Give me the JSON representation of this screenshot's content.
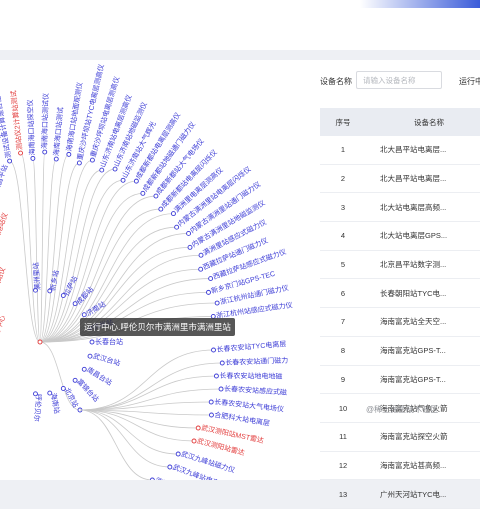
{
  "colors": {
    "link": "#3b3bd6",
    "alert": "#e23a3a",
    "edge": "#c9c9c9",
    "node_fill": "#ffffff"
  },
  "tooltip": {
    "text": "运行中心.呼伦贝尔市满洲里市满洲里站"
  },
  "tree": {
    "left_fragments": [
      {
        "text": "ceshi",
        "color": "link"
      },
      {
        "text": "北大昌平站",
        "color": "link"
      },
      {
        "text": "防城港站仪",
        "color": "alert"
      },
      {
        "text": "测试站仪",
        "color": "alert"
      },
      {
        "text": "运行中心",
        "color": "alert"
      }
    ],
    "fan_labels": [
      {
        "text": "测试设备计算是否在线",
        "color": "link"
      },
      {
        "text": "测站仪2计算站测试",
        "color": "alert"
      },
      {
        "text": "海南海口站探空仪",
        "color": "link"
      },
      {
        "text": "海南海口站测试仪",
        "color": "link"
      },
      {
        "text": "海南海口站测试",
        "color": "link"
      },
      {
        "text": "海南海口站地面观测仪",
        "color": "link"
      },
      {
        "text": "重庆沙坪坝站TYC电离层测高仪",
        "color": "link"
      },
      {
        "text": "重庆沙坪坝站电离层测高仪",
        "color": "link"
      },
      {
        "text": "山东济南站电离层测高仪",
        "color": "link"
      },
      {
        "text": "山东济南站地磁监测仪",
        "color": "link"
      },
      {
        "text": "山东济南站大气辉光",
        "color": "link"
      },
      {
        "text": "成都新都站电离层测高仪",
        "color": "link"
      },
      {
        "text": "成都新都站地磁通门磁力仪",
        "color": "link"
      },
      {
        "text": "成都新都站大气电场仪",
        "color": "link"
      },
      {
        "text": "成都新都站电离层闪烁仪",
        "color": "link"
      },
      {
        "text": "满洲里电离层测高仪",
        "color": "link"
      },
      {
        "text": "内蒙古满洲里站电离层闪烁仪",
        "color": "link"
      },
      {
        "text": "内蒙古满洲里站通门磁力仪",
        "color": "link"
      },
      {
        "text": "内蒙古满洲里站地磁监测仪",
        "color": "link"
      },
      {
        "text": "满洲里站感应式磁力仪",
        "color": "link"
      },
      {
        "text": "西藏拉萨站通门磁力仪",
        "color": "link"
      },
      {
        "text": "西藏拉萨站感应式磁力仪",
        "color": "link"
      },
      {
        "text": "新乡京门站GPS-TEC",
        "color": "link"
      },
      {
        "text": "浙江杭州站通门磁力仪",
        "color": "link"
      },
      {
        "text": "浙江杭州站感应式磁力仪",
        "color": "link"
      }
    ],
    "hub_labels": [
      {
        "text": "满洲里站",
        "color": "link"
      },
      {
        "text": "新乡站",
        "color": "link"
      },
      {
        "text": "拉萨站",
        "color": "link"
      },
      {
        "text": "成都站",
        "color": "link"
      },
      {
        "text": "济南站",
        "color": "link"
      },
      {
        "text": "杭州站",
        "color": "link"
      },
      {
        "text": "长春台站",
        "color": "link"
      },
      {
        "text": "武汉台站",
        "color": "link"
      },
      {
        "text": "南昌台站",
        "color": "link"
      },
      {
        "text": "富锦台站",
        "color": "link"
      },
      {
        "text": "北京站",
        "color": "link"
      },
      {
        "text": "海南站",
        "color": "link"
      },
      {
        "text": "呼伦贝尔",
        "color": "link"
      }
    ],
    "lower_labels": [
      {
        "text": "长春农安站TYC电离层",
        "color": "link"
      },
      {
        "text": "长春农安站通门磁力",
        "color": "link"
      },
      {
        "text": "长春农安站地电地磁",
        "color": "link"
      },
      {
        "text": "长春农安站感应式磁",
        "color": "link"
      },
      {
        "text": "长春农安站大气电场仪",
        "color": "link"
      },
      {
        "text": "合肥科大站电离层",
        "color": "link"
      },
      {
        "text": "武汉测阳站MST雷达",
        "color": "alert"
      },
      {
        "text": "武汉测阳站雷达",
        "color": "alert"
      },
      {
        "text": "武汉九峰站磁力仪",
        "color": "link"
      },
      {
        "text": "武汉九峰站电离层",
        "color": "link"
      },
      {
        "text": "武汉九峰站测高仪",
        "color": "link"
      }
    ]
  },
  "filters": {
    "device_name_label": "设备名称",
    "device_name_placeholder": "请输入设备名称",
    "station_label": "运行中"
  },
  "table": {
    "headers": {
      "index": "序号",
      "name": "设备名称"
    },
    "rows": [
      {
        "index": "1",
        "name": "北大昌平站电离层..."
      },
      {
        "index": "2",
        "name": "北大昌平站电离层..."
      },
      {
        "index": "3",
        "name": "北大站电离层高频..."
      },
      {
        "index": "4",
        "name": "北大站电离层GPS..."
      },
      {
        "index": "5",
        "name": "北京昌平站数字测..."
      },
      {
        "index": "6",
        "name": "长春朝阳站TYC电..."
      },
      {
        "index": "7",
        "name": "海南富克站全天空..."
      },
      {
        "index": "8",
        "name": "海南富克站GPS-T..."
      },
      {
        "index": "9",
        "name": "海南富克站GPS-T..."
      },
      {
        "index": "10",
        "name": "海南富克站气象火箭"
      },
      {
        "index": "11",
        "name": "海南富克站探空火箭"
      },
      {
        "index": "12",
        "name": "海南富克站甚高频..."
      },
      {
        "index": "13",
        "name": "广州天河站TYC电..."
      }
    ]
  },
  "watermark": "@稀土掘金技术社区"
}
